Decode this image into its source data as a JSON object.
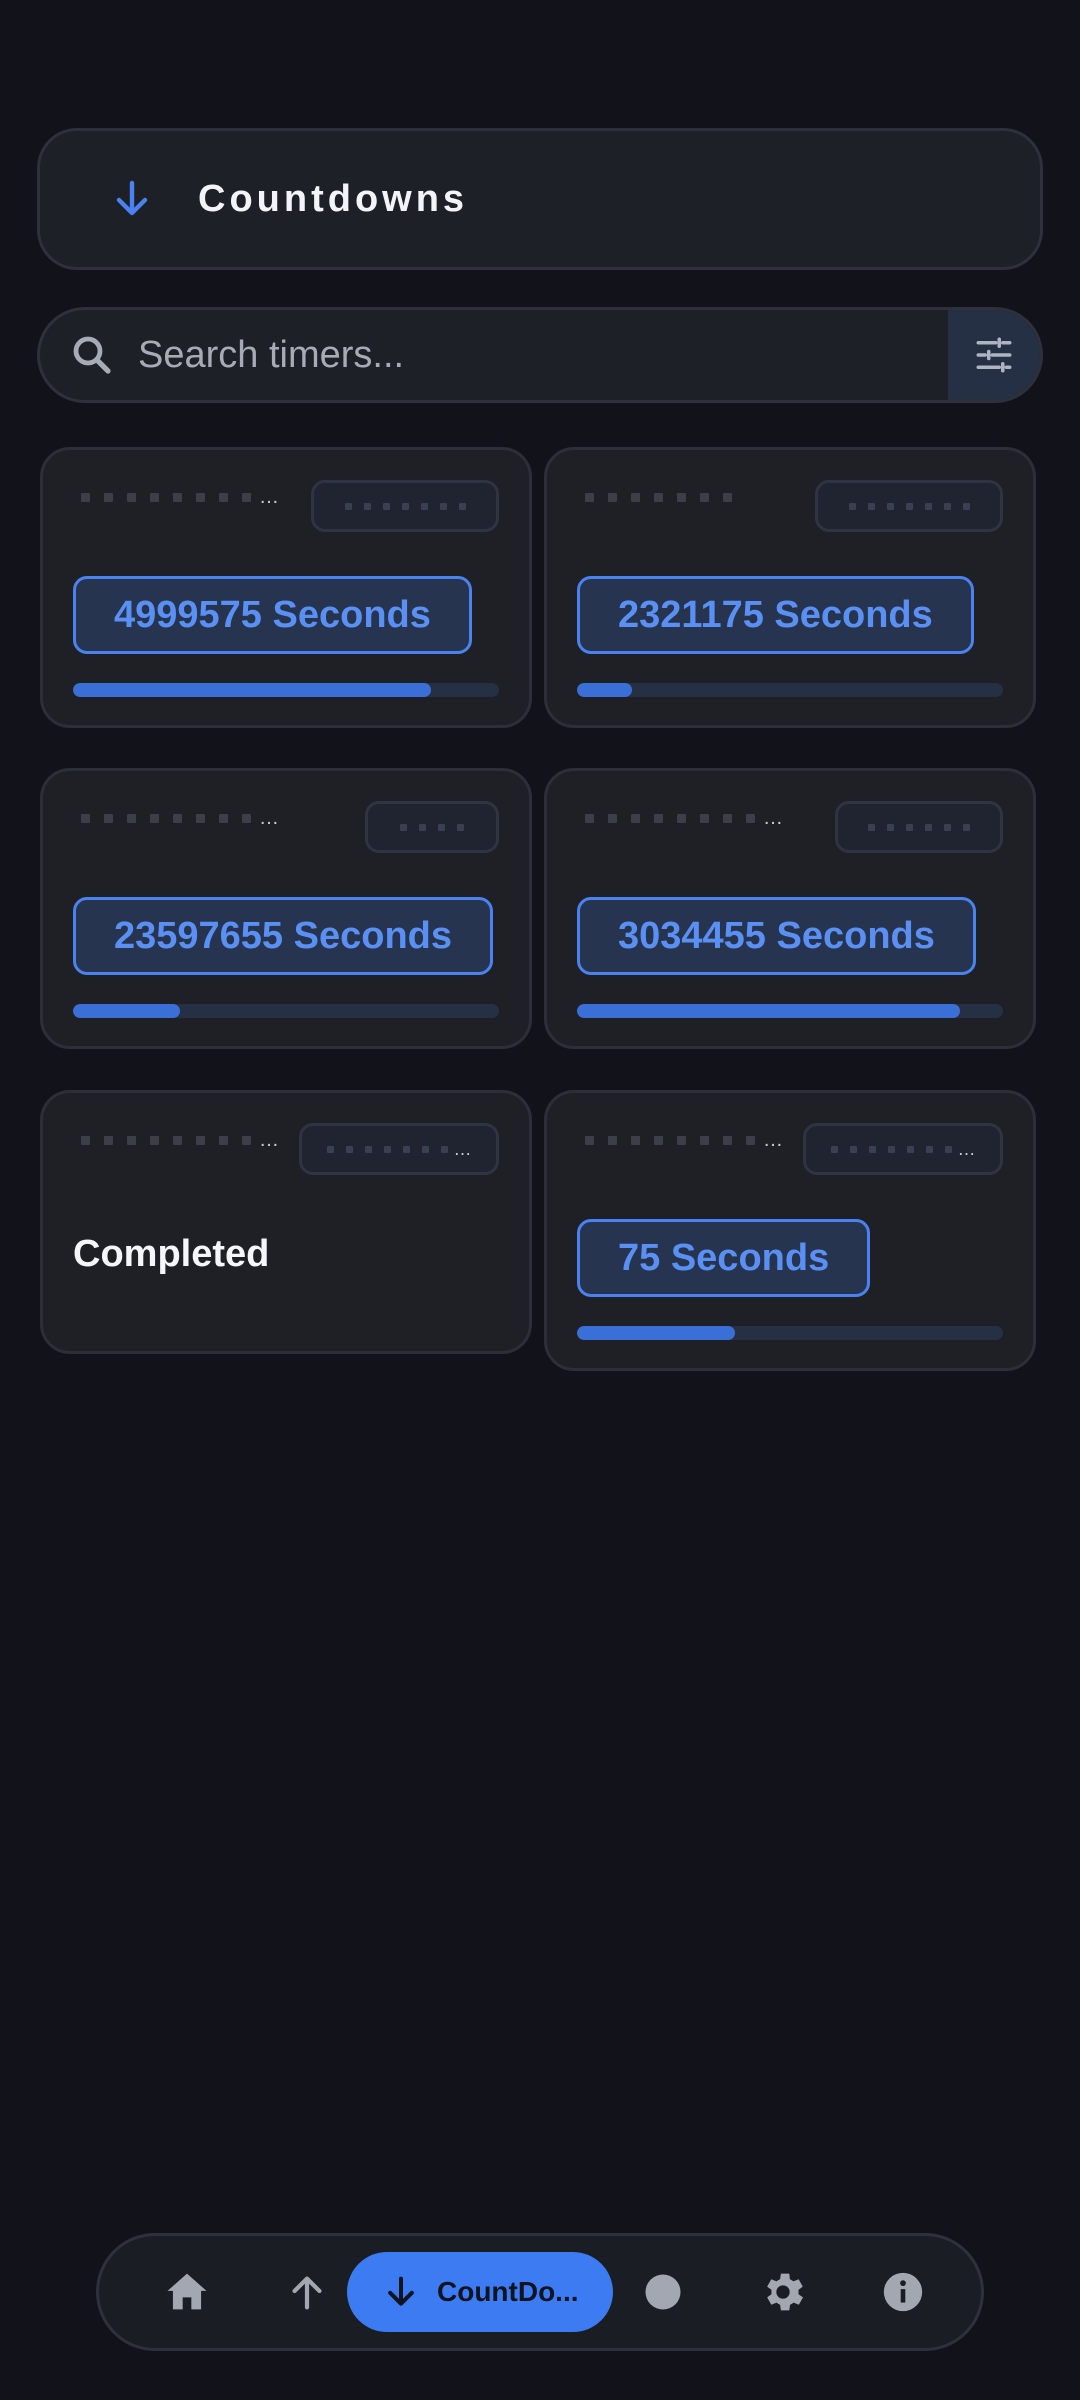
{
  "header": {
    "title": "Countdowns",
    "icon": "arrow-down-icon"
  },
  "search": {
    "placeholder": "Search timers...",
    "icon": "search-icon",
    "filter_icon": "tune-icon"
  },
  "timers": [
    {
      "value_text": "4999575 Seconds",
      "progress": 0.84
    },
    {
      "value_text": "2321175 Seconds",
      "progress": 0.13
    },
    {
      "value_text": "23597655 Seconds",
      "progress": 0.25
    },
    {
      "value_text": "3034455 Seconds",
      "progress": 0.9
    },
    {
      "value_text": "Completed",
      "progress": null
    },
    {
      "value_text": "75 Seconds",
      "progress": 0.37
    }
  ],
  "nav": {
    "items": [
      "home-icon",
      "arrow-up-icon",
      "arrow-down-icon",
      "circle-icon",
      "gear-icon",
      "info-icon"
    ],
    "active_label": "CountDo...",
    "accent": "#3d7bf3"
  },
  "colors": {
    "background": "#12131a",
    "card": "#1e2026",
    "accent": "#4a82f0"
  }
}
